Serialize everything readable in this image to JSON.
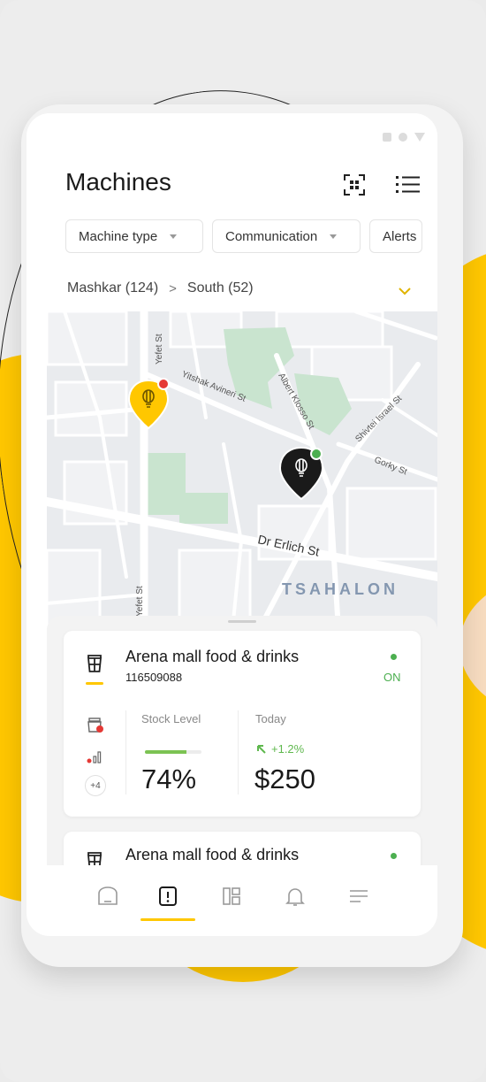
{
  "colors": {
    "accent": "#ffc700",
    "on": "#4caf50",
    "alert": "#e53935"
  },
  "header": {
    "title": "Machines",
    "qr_icon": "qr-scan-icon",
    "list_icon": "list-icon"
  },
  "filters": [
    {
      "label": "Machine type"
    },
    {
      "label": "Communication"
    },
    {
      "label": "Alerts"
    }
  ],
  "breadcrumb": {
    "parent": "Mashkar (124)",
    "separator": ">",
    "current": "South (52)"
  },
  "map": {
    "streets": [
      "Yefet St",
      "Yitshak Avineri St",
      "Albert Klosso St",
      "Shivtei Israel St",
      "Gorky St",
      "Dr Erlich St",
      "Yefet St"
    ],
    "district": "TSAHALON",
    "markers": [
      {
        "name": "alert-machine",
        "status": "alert"
      },
      {
        "name": "online-machine",
        "status": "on"
      }
    ]
  },
  "machines": [
    {
      "name": "Arena mall food & drinks",
      "id": "116509088",
      "status": "ON",
      "stock_label": "Stock Level",
      "stock_percent": 74,
      "stock_value": "74%",
      "today_label": "Today",
      "change": "+1.2%",
      "today_value": "$250",
      "extra_alerts": "+4"
    },
    {
      "name": "Arena mall food & drinks"
    }
  ],
  "navbar": [
    {
      "name": "home",
      "icon": "home-icon"
    },
    {
      "name": "machines",
      "icon": "machine-icon",
      "active": true
    },
    {
      "name": "dashboard",
      "icon": "dashboard-icon"
    },
    {
      "name": "notifications",
      "icon": "bell-icon"
    },
    {
      "name": "menu",
      "icon": "menu-icon"
    }
  ]
}
